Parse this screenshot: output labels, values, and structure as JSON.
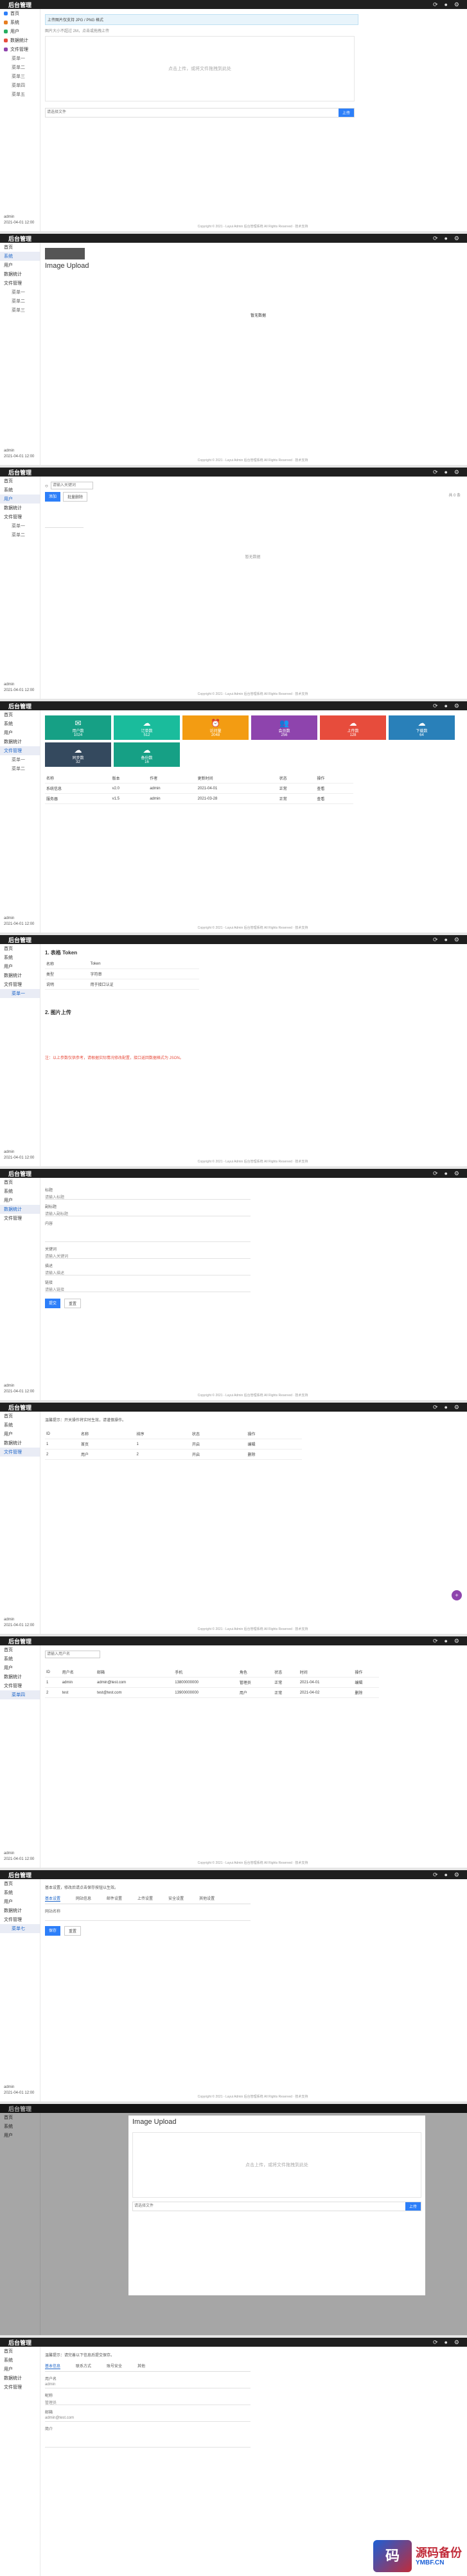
{
  "app": {
    "brand": "后台管理"
  },
  "sidebar": {
    "items": [
      "首页",
      "系统",
      "用户",
      "数据统计",
      "文件管理",
      "系统管理"
    ],
    "sub_items": [
      "菜单一",
      "菜单二",
      "菜单三",
      "菜单四",
      "菜单五",
      "菜单六",
      "菜单七"
    ],
    "footer_user": "admin",
    "footer_time": "2021-04-01 12:00"
  },
  "footer_text": "Copyright © 2021 - Layui Admin 后台管理系统 All Rights Reserved · 技术支持",
  "shot1": {
    "alert": "上传图片仅支持 JPG / PNG 格式",
    "hint": "图片大小不超过 2M，点击或拖拽上传",
    "drop_text": "点击上传，或将文件拖拽到此处",
    "input_placeholder": "请选择文件",
    "upload_button": "上传"
  },
  "shot2": {
    "title": "Image Upload",
    "center_text": "暂无数据"
  },
  "shot3": {
    "search_placeholder": "请输入关键词",
    "btn_add": "添加",
    "btn_batch": "批量删除",
    "right_text": "共 0 条",
    "empty": "暂无数据"
  },
  "shot4": {
    "tiles": [
      {
        "label": "用户数",
        "value": "1024",
        "color": "#16a085",
        "icon": "✉"
      },
      {
        "label": "订单数",
        "value": "512",
        "color": "#1abc9c",
        "icon": "☁"
      },
      {
        "label": "访问量",
        "value": "2048",
        "color": "#f39c12",
        "icon": "⏰"
      },
      {
        "label": "会员数",
        "value": "256",
        "color": "#8e44ad",
        "icon": "👥"
      },
      {
        "label": "上传数",
        "value": "128",
        "color": "#e74c3c",
        "icon": "☁"
      },
      {
        "label": "下载数",
        "value": "64",
        "color": "#2980b9",
        "icon": "☁"
      },
      {
        "label": "同步数",
        "value": "32",
        "color": "#34495e",
        "icon": "☁"
      },
      {
        "label": "备份数",
        "value": "16",
        "color": "#16a085",
        "icon": "☁"
      }
    ],
    "table_head": [
      "名称",
      "版本",
      "作者",
      "更新时间",
      "状态",
      "操作"
    ],
    "table_rows": [
      [
        "系统信息",
        "v2.0",
        "admin",
        "2021-04-01",
        "正常",
        "查看"
      ],
      [
        "服务器",
        "v1.5",
        "admin",
        "2021-03-28",
        "正常",
        "查看"
      ]
    ]
  },
  "shot5": {
    "title1": "1. 表格 Token",
    "title2": "2. 图片上传",
    "rows": [
      [
        "名称",
        "Token"
      ],
      [
        "类型",
        "字符串"
      ],
      [
        "说明",
        "用于接口认证"
      ]
    ],
    "note": "注：以上参数仅供参考，请根据实际情况修改配置，接口返回数据格式为 JSON。"
  },
  "shot6": {
    "labels": [
      "标题",
      "副标题",
      "内容",
      "关键词",
      "描述",
      "链接"
    ],
    "values": [
      "请输入标题",
      "请输入副标题",
      "",
      "请输入关键词",
      "请输入描述",
      "请输入链接"
    ],
    "submit": "提交",
    "reset": "重置"
  },
  "shot7": {
    "notice": "温馨提示：开关操作将实时生效，请谨慎操作。",
    "head": [
      "ID",
      "名称",
      "排序",
      "状态",
      "操作"
    ],
    "rows": [
      [
        "1",
        "首页",
        "1",
        "开启",
        "编辑"
      ],
      [
        "2",
        "用户",
        "2",
        "开启",
        "删除"
      ]
    ]
  },
  "shot8": {
    "search": "请输入用户名",
    "head": [
      "ID",
      "用户名",
      "邮箱",
      "手机",
      "角色",
      "状态",
      "时间",
      "操作"
    ],
    "rows": [
      [
        "1",
        "admin",
        "admin@test.com",
        "13800000000",
        "管理员",
        "正常",
        "2021-04-01",
        "编辑"
      ],
      [
        "2",
        "test",
        "test@test.com",
        "13900000000",
        "用户",
        "正常",
        "2021-04-02",
        "删除"
      ]
    ]
  },
  "shot9": {
    "notice": "基本设置，修改后请点击保存按钮以生效。",
    "tabs": [
      "基本设置",
      "网站信息",
      "邮件设置",
      "上传设置",
      "安全设置",
      "其他设置"
    ],
    "label": "网站名称",
    "save": "保存",
    "reset": "重置"
  },
  "shot10": {
    "title": "Image Upload",
    "drop_text": "点击上传，或将文件拖拽到此处",
    "input_placeholder": "请选择文件",
    "upload_button": "上传"
  },
  "shot11": {
    "notice": "温馨提示：请完善以下信息后提交保存。",
    "tabs": [
      "基本信息",
      "联系方式",
      "账号安全",
      "其他"
    ],
    "labels": [
      "用户名",
      "昵称",
      "邮箱",
      "简介"
    ],
    "values": [
      "admin",
      "管理员",
      "admin@test.com",
      ""
    ]
  },
  "watermark": {
    "brand": "源码备份",
    "url": "YMBF.CN",
    "logo_char": "码"
  }
}
